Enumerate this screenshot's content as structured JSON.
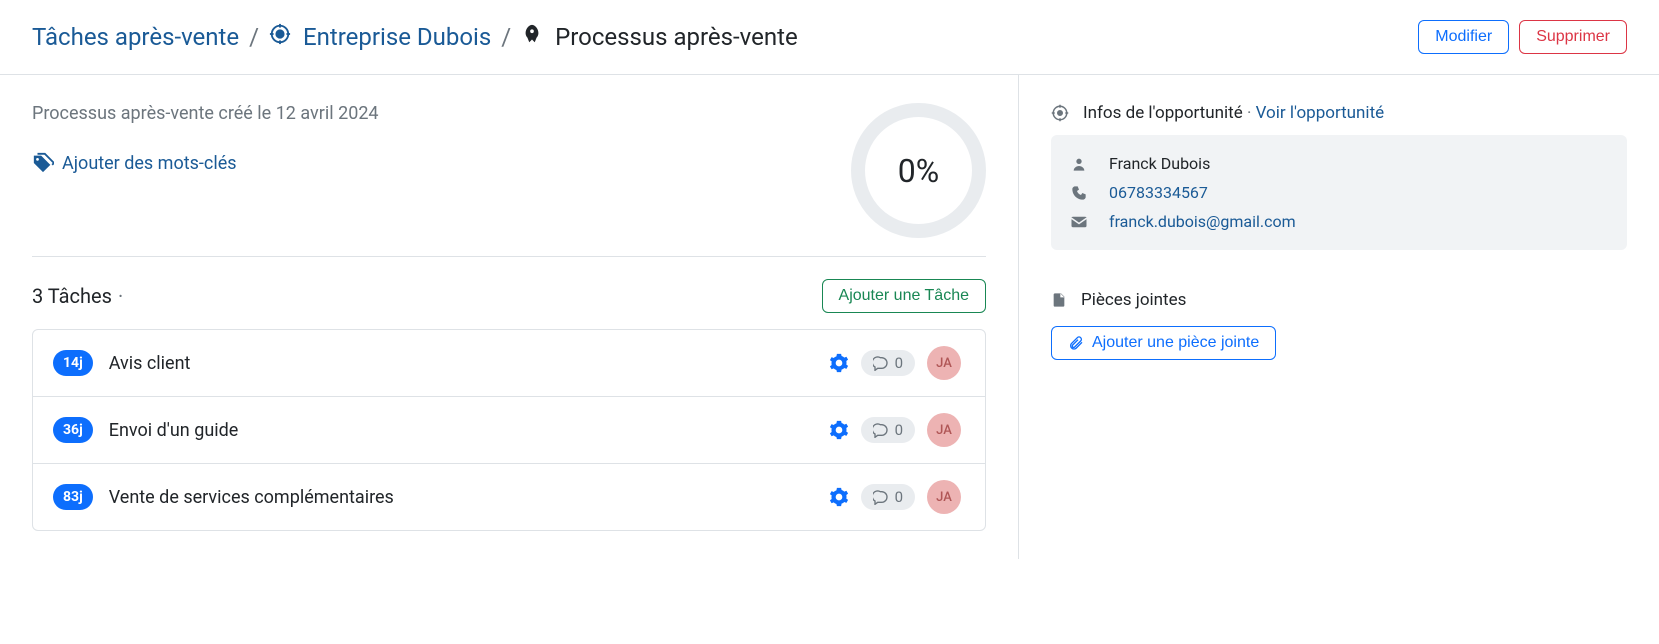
{
  "breadcrumbs": {
    "root": "Tâches après-vente",
    "opportunity": "Entreprise Dubois",
    "process": "Processus après-vente"
  },
  "actions": {
    "edit": "Modifier",
    "delete": "Supprimer"
  },
  "meta": {
    "created": "Processus après-vente créé le 12 avril 2024",
    "add_tags": "Ajouter des mots-clés"
  },
  "progress": {
    "label": "0%"
  },
  "tasks_header": {
    "title": "3 Tâches",
    "add": "Ajouter une Tâche"
  },
  "tasks": [
    {
      "days": "14j",
      "title": "Avis client",
      "comments": "0",
      "assignee": "JA"
    },
    {
      "days": "36j",
      "title": "Envoi d'un guide",
      "comments": "0",
      "assignee": "JA"
    },
    {
      "days": "83j",
      "title": "Vente de services complémentaires",
      "comments": "0",
      "assignee": "JA"
    }
  ],
  "opportunity": {
    "label": "Infos de l'opportunité",
    "view": "Voir l'opportunité",
    "contact_name": "Franck Dubois",
    "phone": "06783334567",
    "email": "franck.dubois@gmail.com"
  },
  "attachments": {
    "title": "Pièces jointes",
    "add": "Ajouter une pièce jointe"
  }
}
